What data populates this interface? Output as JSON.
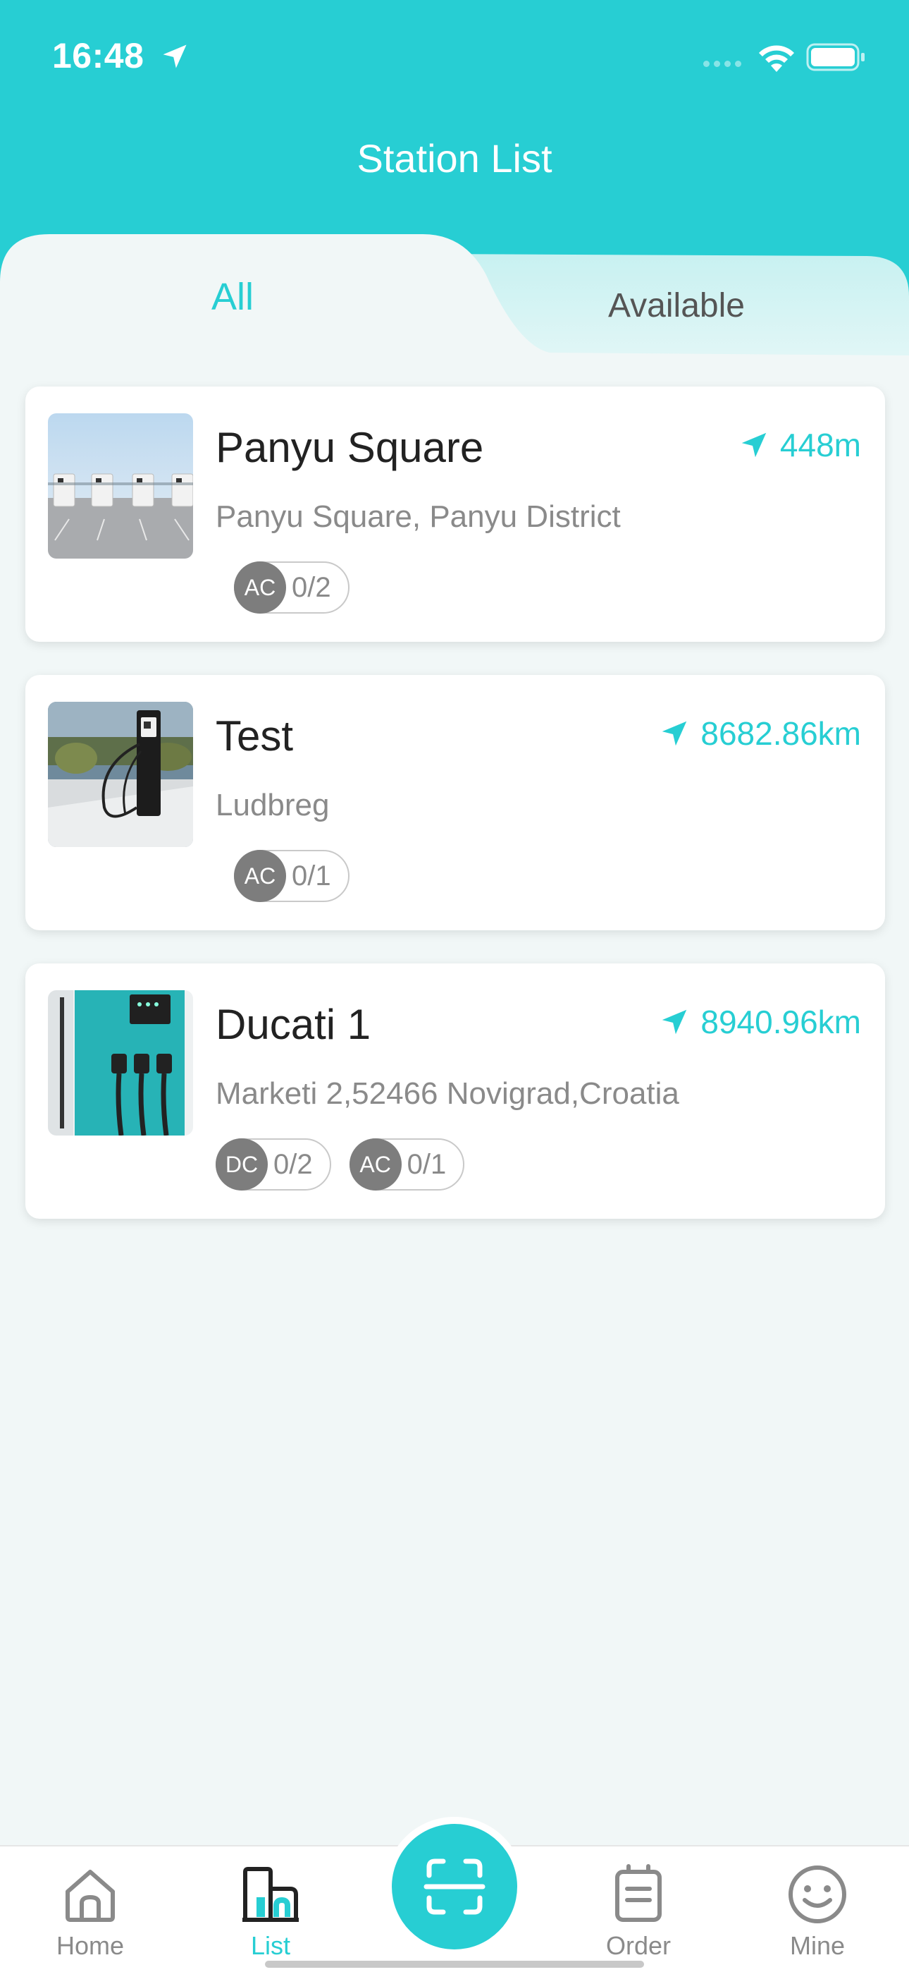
{
  "status_bar": {
    "time": "16:48"
  },
  "header": {
    "title": "Station List"
  },
  "tabs": [
    {
      "label": "All",
      "active": true
    },
    {
      "label": "Available",
      "active": false
    }
  ],
  "stations": [
    {
      "name": "Panyu Square",
      "distance": "448m",
      "address": "Panyu Square, Panyu District",
      "connectors": [
        {
          "type": "AC",
          "count": "0/2"
        }
      ]
    },
    {
      "name": "Test",
      "distance": "8682.86km",
      "address": "Ludbreg",
      "connectors": [
        {
          "type": "AC",
          "count": "0/1"
        }
      ]
    },
    {
      "name": "Ducati 1",
      "distance": "8940.96km",
      "address": "Marketi 2,52466 Novigrad,Croatia",
      "connectors": [
        {
          "type": "DC",
          "count": "0/2"
        },
        {
          "type": "AC",
          "count": "0/1"
        }
      ]
    }
  ],
  "tabbar": {
    "items": [
      {
        "label": "Home",
        "icon": "home-icon",
        "active": false
      },
      {
        "label": "List",
        "icon": "list-icon",
        "active": true
      },
      {
        "label": "",
        "icon": "scan-icon",
        "active": false
      },
      {
        "label": "Order",
        "icon": "order-icon",
        "active": false
      },
      {
        "label": "Mine",
        "icon": "smile-icon",
        "active": false
      }
    ]
  },
  "colors": {
    "accent": "#27ced3",
    "background": "#f1f7f7",
    "badge": "#7d7d7d"
  }
}
